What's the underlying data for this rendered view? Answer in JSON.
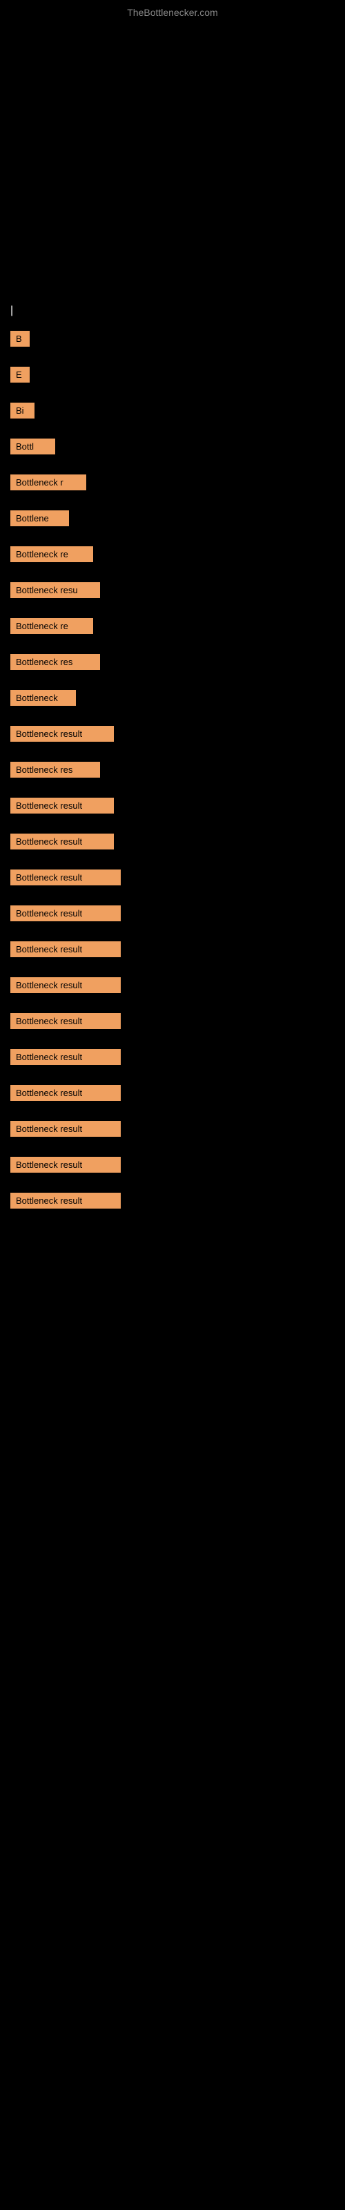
{
  "site": {
    "title": "TheBottlenecker.com"
  },
  "cursor": {
    "symbol": "|"
  },
  "results": [
    {
      "id": 1,
      "label": "B",
      "width_class": "w-20"
    },
    {
      "id": 2,
      "label": "E",
      "width_class": "w-20"
    },
    {
      "id": 3,
      "label": "Bi",
      "width_class": "w-25"
    },
    {
      "id": 4,
      "label": "Bottl",
      "width_class": "w-60"
    },
    {
      "id": 5,
      "label": "Bottleneck r",
      "width_class": "w-100"
    },
    {
      "id": 6,
      "label": "Bottlene",
      "width_class": "w-80"
    },
    {
      "id": 7,
      "label": "Bottleneck re",
      "width_class": "w-110"
    },
    {
      "id": 8,
      "label": "Bottleneck resu",
      "width_class": "w-120"
    },
    {
      "id": 9,
      "label": "Bottleneck re",
      "width_class": "w-110"
    },
    {
      "id": 10,
      "label": "Bottleneck res",
      "width_class": "w-120"
    },
    {
      "id": 11,
      "label": "Bottleneck",
      "width_class": "w-90"
    },
    {
      "id": 12,
      "label": "Bottleneck result",
      "width_class": "w-140"
    },
    {
      "id": 13,
      "label": "Bottleneck res",
      "width_class": "w-120"
    },
    {
      "id": 14,
      "label": "Bottleneck result",
      "width_class": "w-140"
    },
    {
      "id": 15,
      "label": "Bottleneck result",
      "width_class": "w-140"
    },
    {
      "id": 16,
      "label": "Bottleneck result",
      "width_class": "w-150"
    },
    {
      "id": 17,
      "label": "Bottleneck result",
      "width_class": "w-150"
    },
    {
      "id": 18,
      "label": "Bottleneck result",
      "width_class": "w-150"
    },
    {
      "id": 19,
      "label": "Bottleneck result",
      "width_class": "w-150"
    },
    {
      "id": 20,
      "label": "Bottleneck result",
      "width_class": "w-150"
    },
    {
      "id": 21,
      "label": "Bottleneck result",
      "width_class": "w-150"
    },
    {
      "id": 22,
      "label": "Bottleneck result",
      "width_class": "w-150"
    },
    {
      "id": 23,
      "label": "Bottleneck result",
      "width_class": "w-150"
    },
    {
      "id": 24,
      "label": "Bottleneck result",
      "width_class": "w-150"
    },
    {
      "id": 25,
      "label": "Bottleneck result",
      "width_class": "w-150"
    }
  ]
}
